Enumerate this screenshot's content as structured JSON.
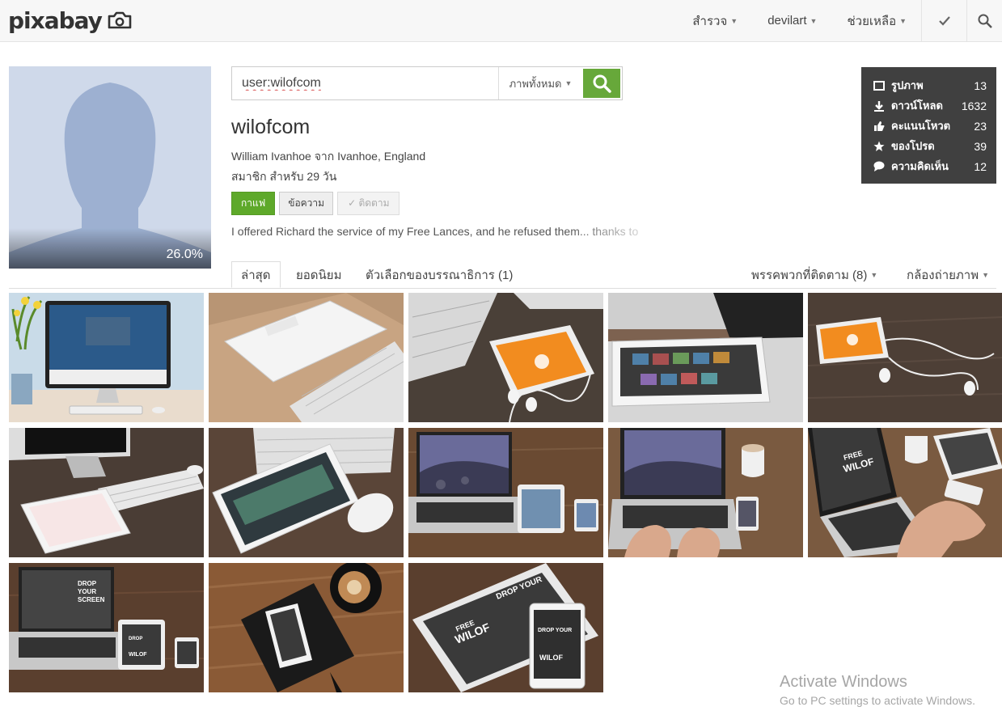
{
  "header": {
    "logo_text": "pixabay",
    "nav": [
      {
        "label": "สำรวจ",
        "has_caret": true
      },
      {
        "label": "devilart",
        "has_caret": true
      },
      {
        "label": "ช่วยเหลือ",
        "has_caret": true
      }
    ],
    "icons": [
      "check-icon",
      "search-icon"
    ]
  },
  "profile": {
    "avatar_percent": "26.0%",
    "username": "wilofcom",
    "location": "William Ivanhoe จาก Ivanhoe, England",
    "member_since": "สมาชิก สำหรับ 29 วัน",
    "buttons": {
      "coffee": "กาแฟ",
      "message": "ข้อความ",
      "follow": "✓ ติดตาม"
    },
    "bio": "I offered Richard the service of my Free Lances, and he refused them... thanks to"
  },
  "search": {
    "value": "user:wilofcom",
    "type_label": "ภาพทั้งหมด"
  },
  "stats": [
    {
      "icon": "image-icon",
      "label": "รูปภาพ",
      "value": "13"
    },
    {
      "icon": "download-icon",
      "label": "ดาวน์โหลด",
      "value": "1632"
    },
    {
      "icon": "thumbs-up-icon",
      "label": "คะแนนโหวต",
      "value": "23"
    },
    {
      "icon": "star-icon",
      "label": "ของโปรด",
      "value": "39"
    },
    {
      "icon": "comment-icon",
      "label": "ความคิดเห็น",
      "value": "12"
    }
  ],
  "tabs": {
    "latest": "ล่าสุด",
    "popular": "ยอดนิยม",
    "editors_choice": "ตัวเลือกของบรรณาธิการ (1)",
    "following": "พรรคพวกที่ติดตาม (8)",
    "cameras": "กล้องถ่ายภาพ"
  },
  "thumbnails": [
    {
      "name": "imac-website-flowers"
    },
    {
      "name": "tablet-google-keyboard"
    },
    {
      "name": "smartphone-orange-earphones"
    },
    {
      "name": "tablet-on-macbook"
    },
    {
      "name": "phone-earphones-wood"
    },
    {
      "name": "imac-tablet-calendar"
    },
    {
      "name": "tablet-website-mouse"
    },
    {
      "name": "macbook-ipad-iphone"
    },
    {
      "name": "hands-macbook-mug"
    },
    {
      "name": "drop-your-screen-hands"
    },
    {
      "name": "drop-your-screen-devices"
    },
    {
      "name": "iphone-coffee-notebook"
    },
    {
      "name": "free-wilof-ipad-iphone"
    }
  ],
  "watermark": {
    "title": "Activate Windows",
    "subtitle": "Go to PC settings to activate Windows."
  },
  "colors": {
    "accent_green": "#5ea92a",
    "stats_bg": "#404040",
    "avatar_bg": "#cfd9ea"
  }
}
